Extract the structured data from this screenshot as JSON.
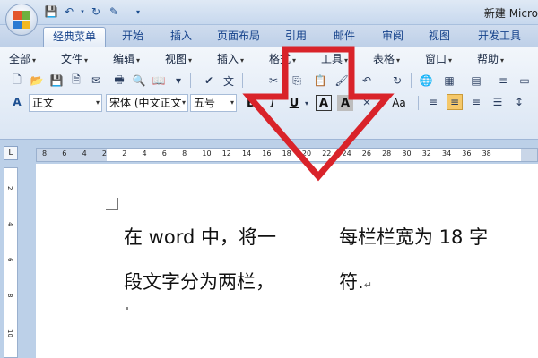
{
  "window": {
    "title": "新建 Micro"
  },
  "tabs": [
    {
      "label": "经典菜单",
      "active": true
    },
    {
      "label": "开始",
      "active": false
    },
    {
      "label": "插入",
      "active": false
    },
    {
      "label": "页面布局",
      "active": false
    },
    {
      "label": "引用",
      "active": false
    },
    {
      "label": "邮件",
      "active": false
    },
    {
      "label": "审阅",
      "active": false
    },
    {
      "label": "视图",
      "active": false
    },
    {
      "label": "开发工具",
      "active": false
    }
  ],
  "menus": [
    {
      "label": "全部"
    },
    {
      "label": "文件"
    },
    {
      "label": "编辑"
    },
    {
      "label": "视图"
    },
    {
      "label": "插入"
    },
    {
      "label": "格式"
    },
    {
      "label": "工具"
    },
    {
      "label": "表格"
    },
    {
      "label": "窗口"
    },
    {
      "label": "帮助"
    }
  ],
  "toolbar": {
    "style_value": "正文",
    "font_value": "宋体 (中文正文)",
    "size_value": "五号",
    "bold_label": "B",
    "italic_label": "I",
    "underline_label": "U",
    "highlight_a_label": "A",
    "shade_a_label": "A",
    "case_label": "Aa"
  },
  "ruler": {
    "corner": "L",
    "ticks": [
      "8",
      "6",
      "4",
      "2",
      "2",
      "4",
      "6",
      "8",
      "10",
      "12",
      "14",
      "16",
      "18",
      "20",
      "22",
      "24",
      "26",
      "28",
      "30",
      "32",
      "34",
      "36",
      "38"
    ],
    "vticks": [
      "2",
      "4",
      "6",
      "8",
      "10"
    ]
  },
  "document": {
    "col1_line1": "在 word 中，将一",
    "col1_line2": "段文字分为两栏，",
    "col2_line1": "每栏栏宽为 18 字",
    "col2_line2": "符.",
    "para_mark": "↵"
  },
  "colors": {
    "arrow": "#d9232a",
    "ribbon_bg": "#dbe6f4",
    "tab_text": "#15428b"
  }
}
